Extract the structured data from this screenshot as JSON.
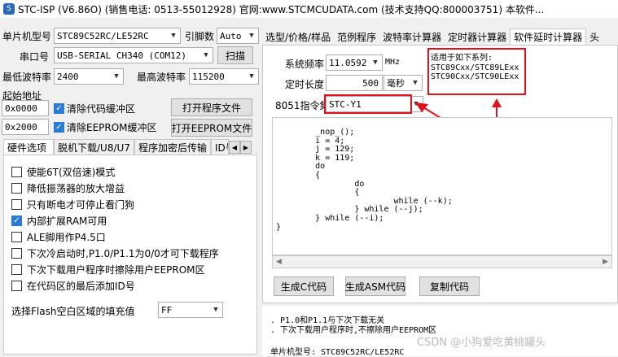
{
  "window": {
    "title": "STC-ISP (V6.86O) (销售电话: 0513-55012928) 官网:www.STCMCUDATA.com  (技术支持QQ:800003751) 本软件..."
  },
  "left": {
    "mcu_label": "单片机型号",
    "mcu_value": "STC89C52RC/LE52RC",
    "pin_label": "引脚数",
    "pin_value": "Auto",
    "port_label": "串口号",
    "port_value": "USB-SERIAL CH340 (COM12)",
    "scan_button": "扫描",
    "min_baud_label": "最低波特率",
    "min_baud_value": "2400",
    "max_baud_label": "最高波特率",
    "max_baud_value": "115200",
    "start_addr_label": "起始地址",
    "addr1": "0x0000",
    "clear_code_label": "清除代码缓冲区",
    "open_program_button": "打开程序文件",
    "addr2": "0x2000",
    "clear_eeprom_label": "清除EEPROM缓冲区",
    "open_eeprom_button": "打开EEPROM文件",
    "tabs": [
      "硬件选项",
      "脱机下载/U8/U7",
      "程序加密后传输",
      "ID号"
    ],
    "options": [
      {
        "label": "使能6T(双倍速)模式",
        "checked": false
      },
      {
        "label": "降低振荡器的放大增益",
        "checked": false
      },
      {
        "label": "只有断电才可停止看门狗",
        "checked": false
      },
      {
        "label": "内部扩展RAM可用",
        "checked": true
      },
      {
        "label": "ALE脚用作P4.5口",
        "checked": false
      },
      {
        "label": "下次冷启动时,P1.0/P1.1为0/0才可下载程序",
        "checked": false
      },
      {
        "label": "下次下载用户程序时擦除用户EEPROM区",
        "checked": false
      },
      {
        "label": "在代码区的最后添加ID号",
        "checked": false
      }
    ],
    "fill_label": "选择Flash空白区域的填充值",
    "fill_value": "FF"
  },
  "right": {
    "tabs": [
      "选型/价格/样品",
      "范例程序",
      "波特率计算器",
      "定时器计算器",
      "软件延时计算器",
      "头"
    ],
    "freq_label": "系统频率",
    "freq_value": "11.0592",
    "freq_unit": "MHz",
    "len_label": "定时长度",
    "len_value": "500",
    "len_unit": "毫秒",
    "isa_label": "8051指令集",
    "isa_value": "STC-Y1",
    "series_title": "适用于如下系列:",
    "series_1": "STC89Cxx/STC89LExx",
    "series_2": "STC90Cxx/STC90LExx",
    "code": "        _nop_();\n        i = 4;\n        j = 129;\n        k = 119;\n        do\n        {\n                do\n                {\n                        while (--k);\n                } while (--j);\n        } while (--i);\n}",
    "gen_c_button": "生成C代码",
    "gen_asm_button": "生成ASM代码",
    "copy_button": "复制代码",
    "notes": [
      ". P1.0和P1.1与下次下载无关",
      ". 下次下载用户程序时,不擦除用户EEPROM区"
    ],
    "bottom_mcu": "单片机型号: STC89C52RC/LE52RC"
  },
  "watermark": "CSDN @小狗爱吃黄桃罐头"
}
